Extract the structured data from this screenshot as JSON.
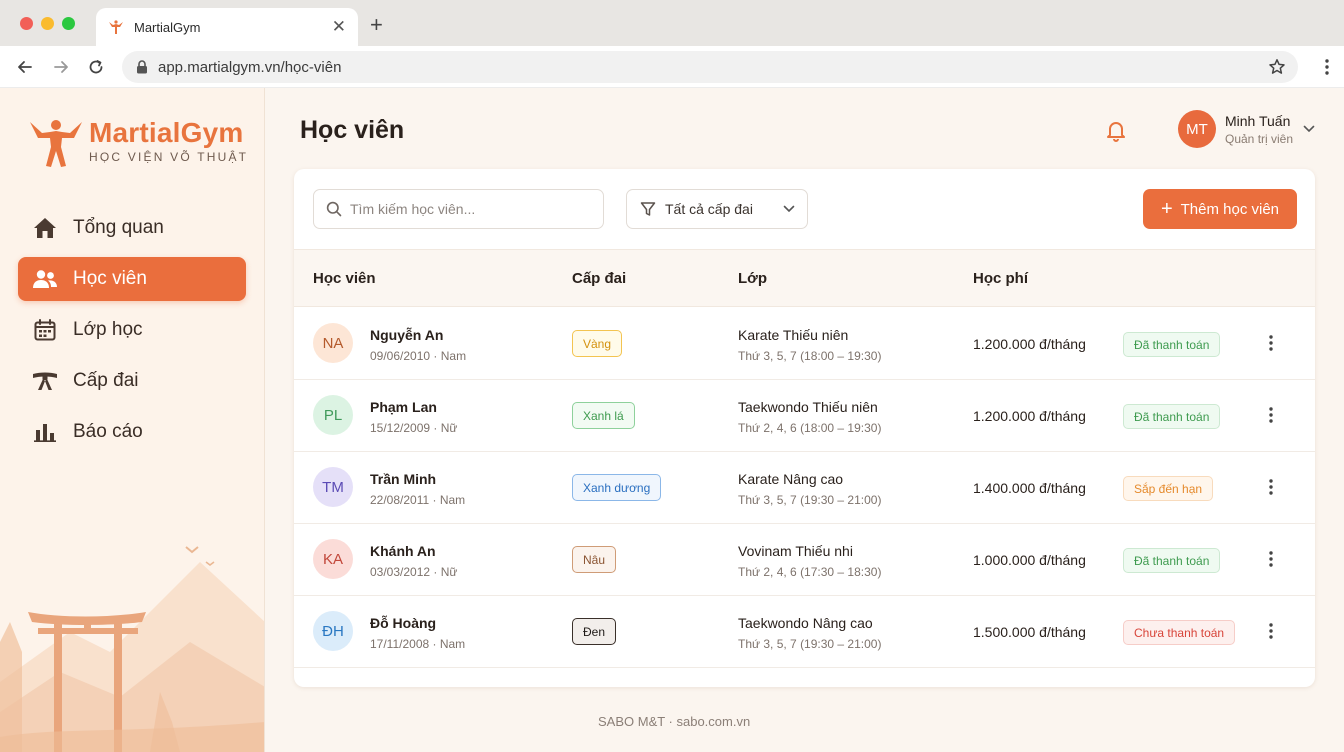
{
  "browser": {
    "tab_title": "MartialGym",
    "url": "app.martialgym.vn/học-viên",
    "icons": [
      "back-arrow-icon",
      "forward-arrow-icon",
      "reload-icon",
      "lock-icon",
      "star-icon",
      "more-vertical-icon"
    ]
  },
  "brand": {
    "name": "MartialGym",
    "tagline": "HỌC VIỆN VÕ THUẬT",
    "color": "#e8743e"
  },
  "sidebar": {
    "items": [
      {
        "label": "Tổng quan",
        "icon": "home-icon",
        "active": false
      },
      {
        "label": "Học viên",
        "icon": "users-icon",
        "active": true
      },
      {
        "label": "Lớp học",
        "icon": "calendar-icon",
        "active": false
      },
      {
        "label": "Cấp đai",
        "icon": "belt-icon",
        "active": false
      },
      {
        "label": "Báo cáo",
        "icon": "bar-chart-icon",
        "active": false
      }
    ]
  },
  "header": {
    "title": "Học viên",
    "user": {
      "initials": "MT",
      "name": "Minh Tuấn",
      "role": "Quản trị viên"
    }
  },
  "toolbar": {
    "search_placeholder": "Tìm kiếm học viên...",
    "filter_label": "Tất cả cấp đai",
    "add_label": "Thêm học viên"
  },
  "table": {
    "columns": [
      "Học viên",
      "Cấp đai",
      "Lớp",
      "Học phí"
    ],
    "rows": [
      {
        "initials": "NA",
        "name": "Nguyễn An",
        "meta": "09/06/2010 · Nam",
        "belt": "Vàng",
        "class": "Karate Thiếu niên",
        "schedule": "Thứ 3, 5, 7 (18:00 – 19:30)",
        "fee": "1.200.000 đ/tháng",
        "status": "Đã thanh toán"
      },
      {
        "initials": "PL",
        "name": "Phạm Lan",
        "meta": "15/12/2009 · Nữ",
        "belt": "Xanh lá",
        "class": "Taekwondo Thiếu niên",
        "schedule": "Thứ 2, 4, 6 (18:00 – 19:30)",
        "fee": "1.200.000 đ/tháng",
        "status": "Đã thanh toán"
      },
      {
        "initials": "TM",
        "name": "Trần Minh",
        "meta": "22/08/2011 · Nam",
        "belt": "Xanh dương",
        "class": "Karate Nâng cao",
        "schedule": "Thứ 3, 5, 7 (19:30 – 21:00)",
        "fee": "1.400.000 đ/tháng",
        "status": "Sắp đến hạn"
      },
      {
        "initials": "KA",
        "name": "Khánh An",
        "meta": "03/03/2012 · Nữ",
        "belt": "Nâu",
        "class": "Vovinam Thiếu nhi",
        "schedule": "Thứ 2, 4, 6 (17:30 – 18:30)",
        "fee": "1.000.000 đ/tháng",
        "status": "Đã thanh toán"
      },
      {
        "initials": "ĐH",
        "name": "Đỗ Hoàng",
        "meta": "17/11/2008 · Nam",
        "belt": "Đen",
        "class": "Taekwondo Nâng cao",
        "schedule": "Thứ 3, 5, 7 (19:30 – 21:00)",
        "fee": "1.500.000 đ/tháng",
        "status": "Chưa thanh toán"
      }
    ]
  },
  "footer": {
    "text": "SABO M&T · sabo.com.vn"
  }
}
